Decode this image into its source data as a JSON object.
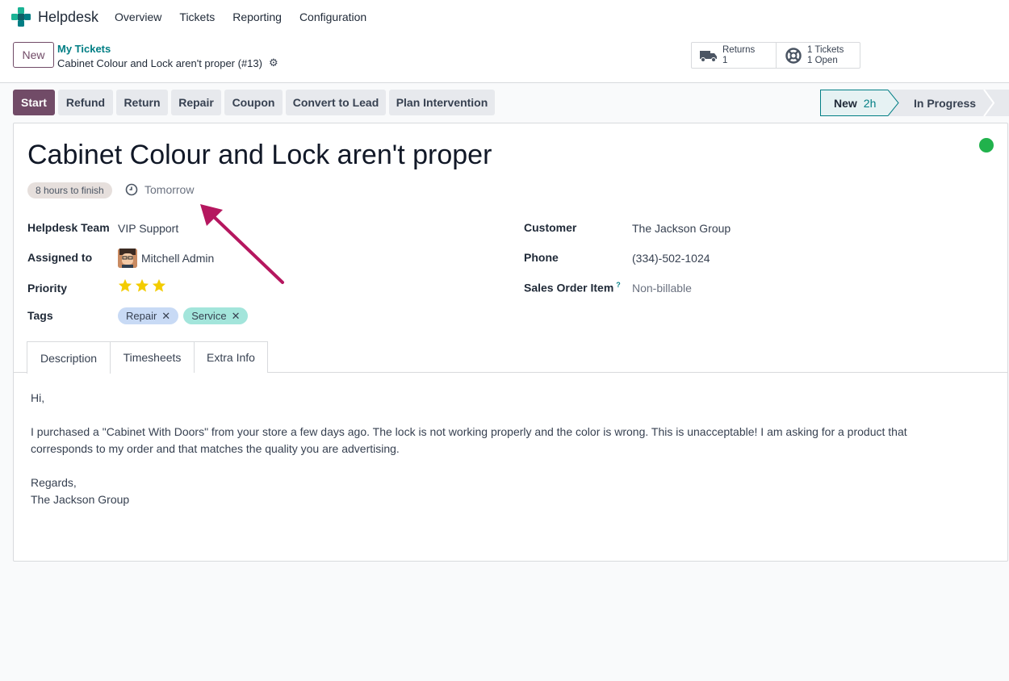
{
  "navbar": {
    "app_name": "Helpdesk",
    "items": [
      "Overview",
      "Tickets",
      "Reporting",
      "Configuration"
    ]
  },
  "control": {
    "new_label": "New",
    "breadcrumb_parent": "My Tickets",
    "breadcrumb_current": "Cabinet Colour and Lock aren't proper (#13)",
    "smart_returns": {
      "label": "Returns",
      "count": "1"
    },
    "smart_tickets": {
      "line1": "1 Tickets",
      "line2": "1 Open"
    }
  },
  "actions": [
    "Start",
    "Refund",
    "Return",
    "Repair",
    "Coupon",
    "Convert to Lead",
    "Plan Intervention"
  ],
  "statusbar": {
    "active_stage": "New",
    "active_duration": "2h",
    "next_stage": "In Progress",
    "more": "..."
  },
  "ticket": {
    "title": "Cabinet Colour and Lock aren't proper",
    "sla": "8 hours to finish",
    "deadline": "Tomorrow",
    "kanban_state_color": "#21b24c"
  },
  "fields": {
    "team_label": "Helpdesk Team",
    "team_value": "VIP Support",
    "assigned_label": "Assigned to",
    "assigned_value": "Mitchell Admin",
    "priority_label": "Priority",
    "priority_stars": 3,
    "tags_label": "Tags",
    "tags": [
      "Repair",
      "Service"
    ],
    "customer_label": "Customer",
    "customer_value": "The Jackson Group",
    "phone_label": "Phone",
    "phone_value": "(334)-502-1024",
    "soi_label": "Sales Order Item",
    "soi_help": "?",
    "soi_value": "Non-billable"
  },
  "tabs": [
    "Description",
    "Timesheets",
    "Extra Info"
  ],
  "description": {
    "greeting": "Hi,",
    "body_line1": "I purchased a \"Cabinet With Doors\" from your store a few days ago. The lock is not working properly and the color is wrong. This is unacceptable! I am asking for a product that",
    "body_line2": "corresponds to my order and that matches the quality you are advertising.",
    "closing": "Regards,",
    "signature": "The Jackson Group"
  },
  "colors": {
    "brand": "#714b67",
    "teal": "#017e84",
    "annotation_arrow": "#b5175f"
  }
}
